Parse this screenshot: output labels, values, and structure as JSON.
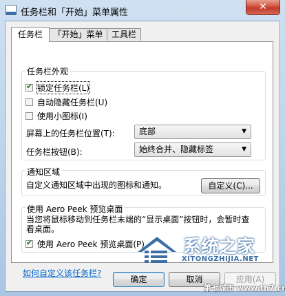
{
  "window": {
    "title": "任务栏和「开始」菜单属性",
    "close_glyph": "✕"
  },
  "tabs": [
    {
      "label": "任务栏",
      "active": true
    },
    {
      "label": "「开始」菜单",
      "active": false
    },
    {
      "label": "工具栏",
      "active": false
    }
  ],
  "appearance": {
    "title": "任务栏外观",
    "options": [
      {
        "label": "锁定任务栏(L)",
        "checked": true
      },
      {
        "label": "自动隐藏任务栏(U)",
        "checked": false
      },
      {
        "label": "使用小图标(I)",
        "checked": false
      }
    ],
    "location_label": "屏幕上的任务栏位置(T):",
    "location_value": "底部",
    "buttons_label": "任务栏按钮(B):",
    "buttons_value": "始终合并、隐藏标签"
  },
  "notification": {
    "title": "通知区域",
    "description": "自定义通知区域中出现的图标和通知。",
    "customize_button": "自定义(C)..."
  },
  "aero_peek": {
    "title": "使用 Aero Peek 预览桌面",
    "description": "当您将鼠标移动到任务栏末端的“显示桌面”按钮时，会暂时查看桌面。",
    "option_label": "使用 Aero Peek 预览桌面(P)",
    "option_checked": true
  },
  "help_link": "如何自定义该任务栏?",
  "footer": {
    "ok": "确定",
    "cancel": "取消",
    "apply": "应用(A)"
  },
  "watermark": {
    "title": "系统之家",
    "subtitle": "XITONGZHIJIA.NET",
    "stamp": "第七城市 www.th7.cn"
  }
}
